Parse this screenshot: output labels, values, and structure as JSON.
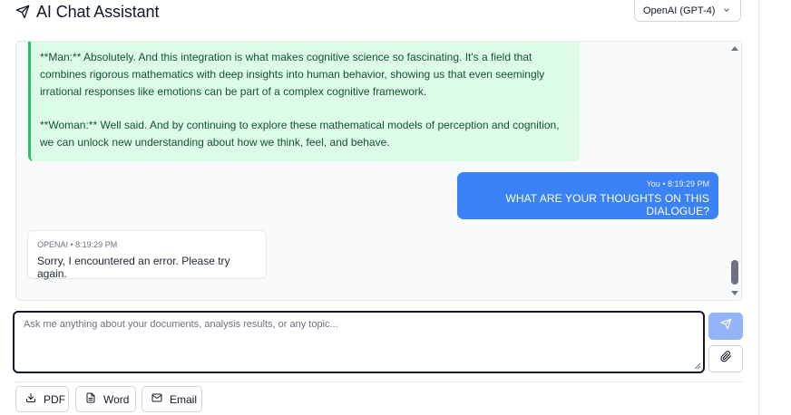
{
  "header": {
    "title": "AI Chat Assistant",
    "model_selected": "OpenAI (GPT-4)"
  },
  "messages": [
    {
      "role": "assistant",
      "paragraphs": [
        "**Man:** Absolutely. And this integration is what makes cognitive science so fascinating. It's a field that combines rigorous mathematics with deep insights into human behavior, showing us that even seemingly irrational responses like emotions can be part of a complex cognitive framework.",
        "**Woman:** Well said. And by continuing to explore these mathematical models of perception and cognition, we can unlock new understanding about how we think, feel, and behave."
      ]
    },
    {
      "role": "user",
      "meta": "You • 8:19:29 PM",
      "text": "WHAT ARE YOUR THOUGHTS ON THIS DIALOGUE?"
    },
    {
      "role": "assistant",
      "meta": "OPENAI • 8:19:29 PM",
      "text": "Sorry, I encountered an error. Please try again."
    }
  ],
  "input": {
    "value": "",
    "placeholder": "Ask me anything about your documents, analysis results, or any topic..."
  },
  "export": {
    "pdf_label": "PDF",
    "word_label": "Word",
    "email_label": "Email"
  },
  "colors": {
    "ai_bubble_bg": "#dcfce7",
    "ai_bubble_border": "#22c55e",
    "user_bubble_bg": "#3b82f6",
    "send_button_bg": "#93b4f8"
  },
  "icons": {
    "title": "send-plane-icon",
    "select": "chevron-down-icon",
    "send": "send-plane-icon",
    "attach": "paperclip-icon",
    "pdf": "download-icon",
    "word": "document-icon",
    "email": "mail-icon"
  }
}
